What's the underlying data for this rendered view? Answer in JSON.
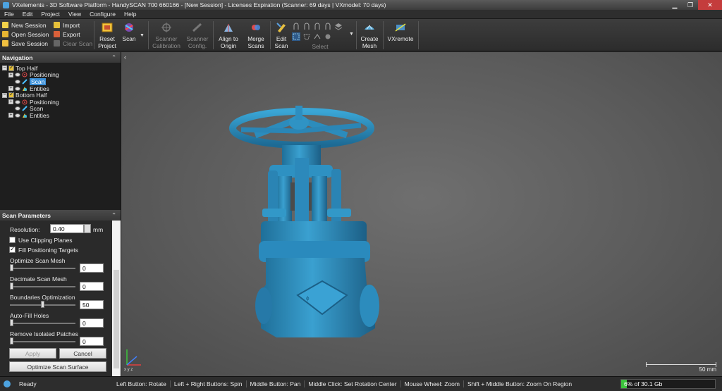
{
  "window": {
    "title": "VXelements - 3D Software Platform - HandySCAN 700 660166 - [New Session] - Licenses Expiration (Scanner: 69 days | VXmodel: 70 days)"
  },
  "menu": [
    "File",
    "Edit",
    "Project",
    "View",
    "Configure",
    "Help"
  ],
  "toolbar": {
    "session": {
      "new": "New Session",
      "open": "Open Session",
      "save": "Save Session"
    },
    "file": {
      "import": "Import",
      "export": "Export",
      "clear_scan": "Clear Scan"
    },
    "reset_project": [
      "Reset",
      "Project"
    ],
    "scan": "Scan",
    "scanner_calibration": [
      "Scanner",
      "Calibration"
    ],
    "scanner_config": [
      "Scanner",
      "Config."
    ],
    "align_to_origin": [
      "Align to",
      "Origin"
    ],
    "merge_scans": [
      "Merge",
      "Scans"
    ],
    "edit_scan": [
      "Edit",
      "Scan"
    ],
    "select": "Select",
    "create_mesh": [
      "Create",
      "Mesh"
    ],
    "vxremote": "VXremote"
  },
  "navigation": {
    "title": "Navigation",
    "tree": {
      "top_half": "Top Half",
      "top_positioning": "Positioning",
      "top_scan": "Scan",
      "top_entities": "Entities",
      "bottom_half": "Bottom Half",
      "bottom_positioning": "Positioning",
      "bottom_scan": "Scan",
      "bottom_entities": "Entities"
    }
  },
  "scan_params": {
    "title": "Scan Parameters",
    "resolution_label": "Resolution:",
    "resolution_value": "0.40",
    "resolution_unit": "mm",
    "use_clipping_planes": "Use Clipping Planes",
    "use_clipping_planes_checked": false,
    "fill_positioning_targets": "Fill Positioning Targets",
    "fill_positioning_targets_checked": true,
    "optimize_scan_mesh_label": "Optimize Scan Mesh",
    "optimize_scan_mesh_value": "0",
    "decimate_scan_mesh_label": "Decimate Scan Mesh",
    "decimate_scan_mesh_value": "0",
    "boundaries_optimization_label": "Boundaries Optimization",
    "boundaries_optimization_value": "50",
    "auto_fill_holes_label": "Auto-Fill Holes",
    "auto_fill_holes_value": "0",
    "remove_isolated_patches_label": "Remove Isolated Patches",
    "remove_isolated_patches_value": "0",
    "apply": "Apply",
    "cancel": "Cancel",
    "optimize_scan_surface": "Optimize Scan Surface"
  },
  "viewport": {
    "scale_label": "50 mm",
    "axis_label": "x y z"
  },
  "status": {
    "ready": "Ready",
    "hints": [
      "Left Button: Rotate",
      "Left + Right Buttons: Spin",
      "Middle Button: Pan",
      "Middle Click: Set Rotation Center",
      "Mouse Wheel: Zoom",
      "Shift + Middle Button: Zoom On Region"
    ],
    "memory_text": "6% of 30.1 Gb",
    "memory_fraction": 0.06
  },
  "colors": {
    "model": "#2f8fbf",
    "accent": "#3a8fd8",
    "memory": "#3cc43c"
  }
}
